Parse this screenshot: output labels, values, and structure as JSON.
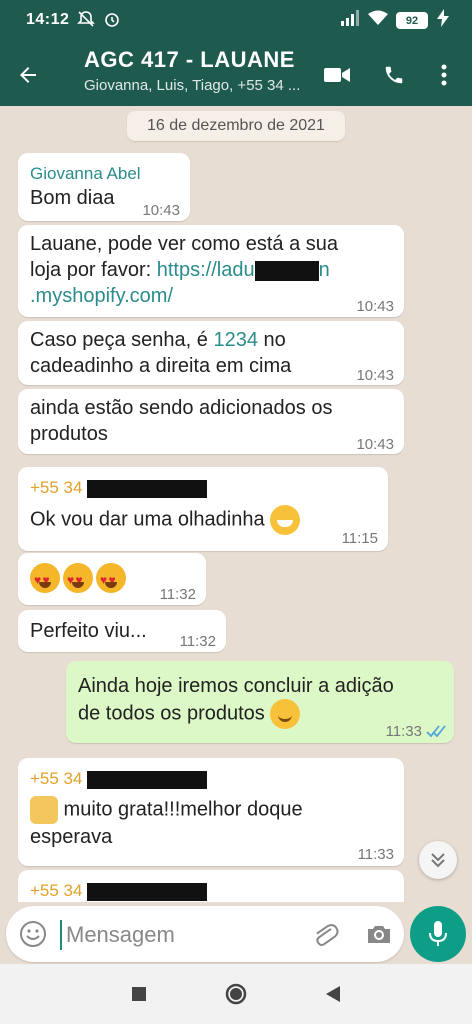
{
  "status_bar": {
    "time": "14:12",
    "battery": "92",
    "icons": [
      "mute-icon",
      "alarm-icon",
      "signal-icon",
      "wifi-icon",
      "battery-icon",
      "charging-icon"
    ]
  },
  "header": {
    "title": "AGC 417 - LAUANE",
    "subtitle": "Giovanna, Luis, Tiago, +55 34 ...",
    "icons": [
      "back-arrow-icon",
      "video-call-icon",
      "phone-icon",
      "more-vert-icon"
    ]
  },
  "chat": {
    "date": "16 de dezembro de 2021",
    "messages": [
      {
        "sender": "Giovanna Abel",
        "text": "Bom diaa",
        "time": "10:43"
      },
      {
        "text_1": "Lauane, pode ver como está a sua",
        "text_2": "loja por favor: ",
        "link_1": "https://ladu",
        "link_2": "n",
        "link_3": ".myshopify.com/",
        "time": "10:43"
      },
      {
        "text_1": "Caso peça senha, é ",
        "code": "1234",
        "text_2": " no",
        "text_3": "cadeadinho a direita em cima",
        "time": "10:43"
      },
      {
        "text_1": "ainda estão sendo adicionados os",
        "text_2": "produtos",
        "time": "10:43"
      },
      {
        "sender": "+55 34",
        "text": "Ok vou dar uma olhadinha",
        "emoji": "grinning-face",
        "time": "11:15"
      },
      {
        "emoji": "heart-eyes x3",
        "time": "11:32"
      },
      {
        "text": "Perfeito viu...",
        "time": "11:32"
      },
      {
        "outgoing": true,
        "text_1": "Ainda hoje iremos concluir a adição",
        "text_2": "de todos os produtos",
        "emoji": "smiling-face",
        "time": "11:33",
        "status": "read"
      },
      {
        "sender": "+55 34",
        "emoji": "raised-hands",
        "text_1": " muito grata!!!melhor doque",
        "text_2": "esperava",
        "time": "11:33"
      },
      {
        "sender": "+55 34"
      }
    ]
  },
  "composer": {
    "placeholder": "Mensagem",
    "icons": [
      "emoji-icon",
      "attach-icon",
      "camera-icon",
      "mic-icon"
    ]
  },
  "nav_bar": {
    "icons": [
      "recents-icon",
      "home-icon",
      "back-icon"
    ]
  },
  "colors": {
    "header": "#1f5a4f",
    "background": "#e8ddd3",
    "outgoing": "#dcf8c6",
    "link": "#2a8c8b",
    "phone_sender": "#e2a12a",
    "accent": "#0e9e87"
  }
}
